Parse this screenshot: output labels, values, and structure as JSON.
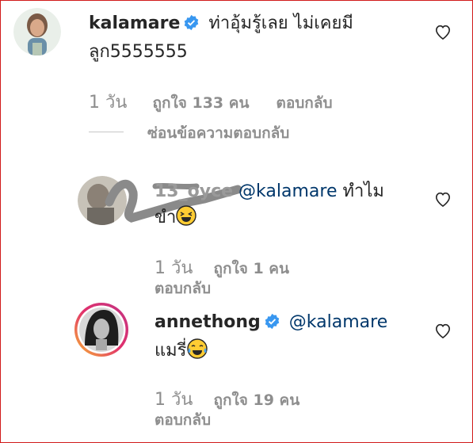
{
  "comments": [
    {
      "username": "kalamare",
      "verified": true,
      "text_line1": "ท่าอุ้มรู้เลย ไม่เคยมี",
      "text_line2": "ลูก5555555",
      "time": "1 วัน",
      "likes": "ถูกใจ 133 คน",
      "reply": "ตอบกลับ"
    }
  ],
  "hide_replies": "ซ่อนข้อความตอบกลับ",
  "replies": [
    {
      "username_obscured": "13_oyce",
      "mention": "@kalamare",
      "text_after_mention": " ทำไม",
      "text_line2": "ขำ",
      "time": "1 วัน",
      "likes": "ถูกใจ 1 คน",
      "reply": "ตอบกลับ"
    },
    {
      "username": "annethong",
      "verified": true,
      "mention": "@kalamare",
      "text_line2": "แมรี่",
      "time": "1 วัน",
      "likes": "ถูกใจ 19 คน",
      "reply": "ตอบกลับ"
    }
  ],
  "colors": {
    "text": "#262626",
    "secondary": "#8e8e8e",
    "mention": "#00376b",
    "verified": "#3897f0",
    "frame": "#d11a1a"
  }
}
